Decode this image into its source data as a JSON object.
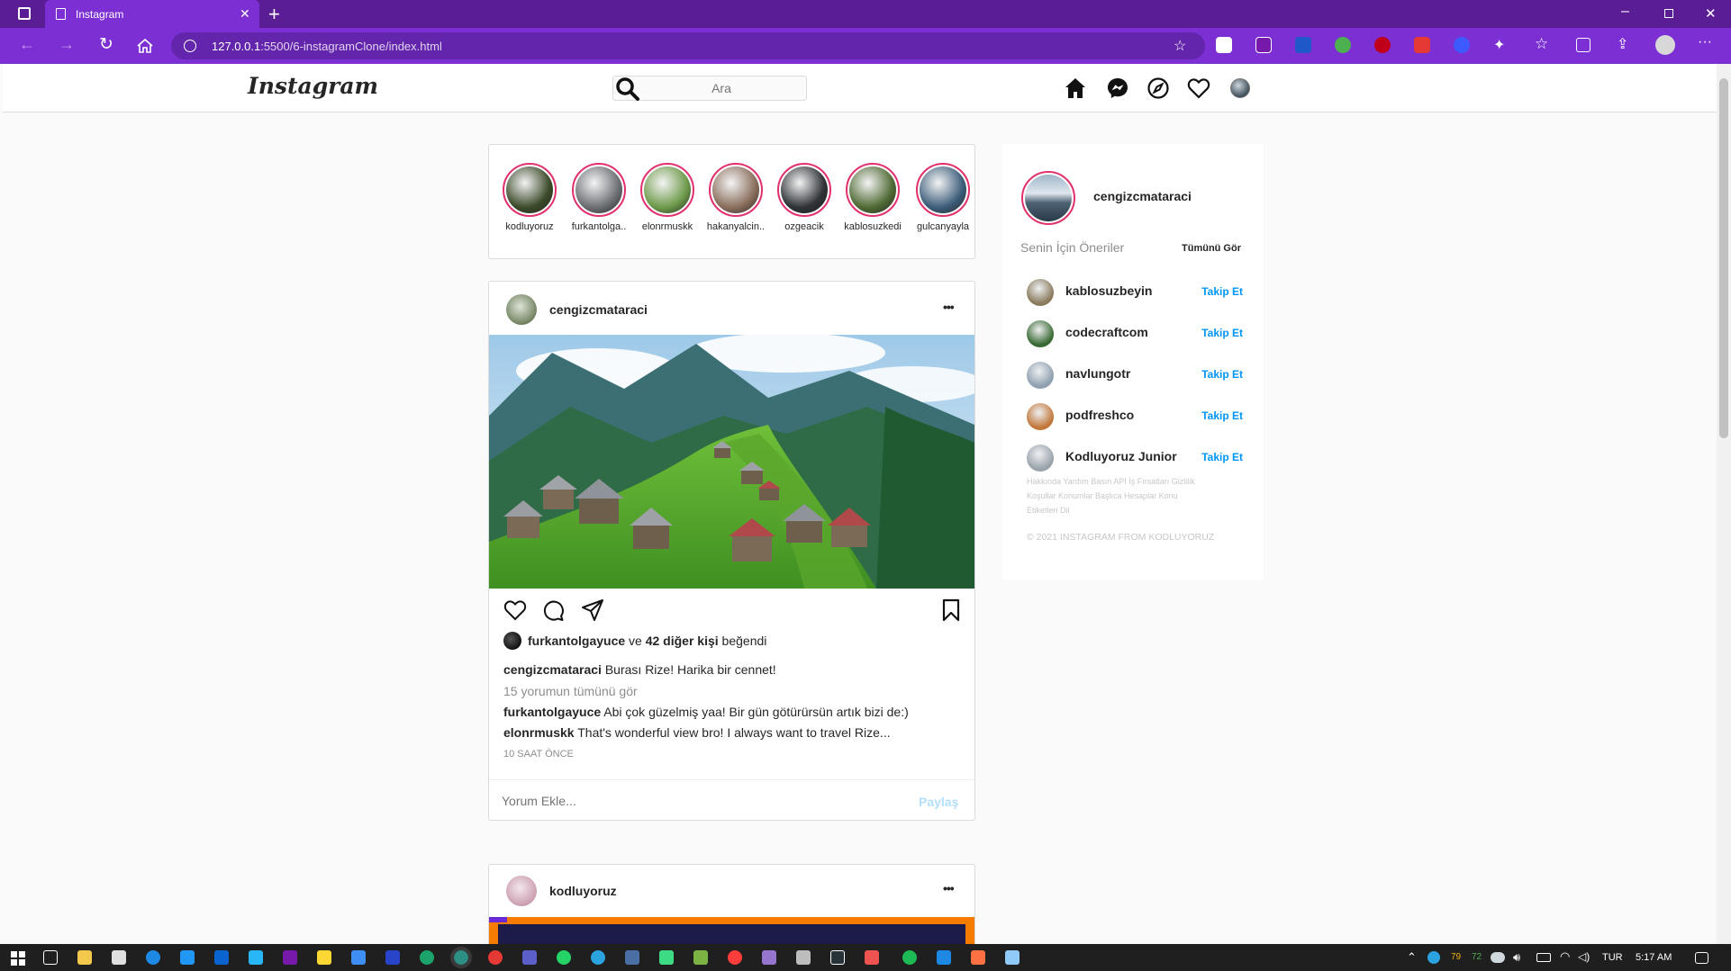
{
  "browser": {
    "tab_title": "Instagram",
    "url_host": "127.0.0.1",
    "url_rest": ":5500/6-instagramClone/index.html",
    "colors": {
      "tabbar": "#5a1d94",
      "toolbar": "#7c2fd3"
    }
  },
  "header": {
    "logo": "Instagram",
    "search_placeholder": "Ara",
    "icons": [
      "home-icon",
      "messenger-icon",
      "explore-icon",
      "heart-icon",
      "profile-avatar"
    ]
  },
  "stories": [
    {
      "name": "kodluyoruz",
      "color": "#3b4a2a"
    },
    {
      "name": "furkantolga..",
      "color": "#6b6e73"
    },
    {
      "name": "elonrmuskk",
      "color": "#6d9a4a"
    },
    {
      "name": "hakanyalcin..",
      "color": "#8a6e5c"
    },
    {
      "name": "ozgeacik",
      "color": "#2e3236"
    },
    {
      "name": "kablosuzkedi",
      "color": "#4f6a34"
    },
    {
      "name": "gulcanyayla",
      "color": "#3c5d7a"
    }
  ],
  "post": {
    "username": "cengizcmataraci",
    "more": "•••",
    "likes_user": "furkantolgayuce",
    "likes_connector": "ve",
    "likes_others": "42 diğer kişi",
    "likes_suffix": "beğendi",
    "caption_user": "cengizcmataraci",
    "caption": "Burası Rize! Harika bir cennet!",
    "view_all": "15 yorumun tümünü gör",
    "comments": [
      {
        "user": "furkantolgayuce",
        "text": "Abi çok güzelmiş yaa! Bir gün götürürsün artık bizi de:)"
      },
      {
        "user": "elonrmuskk",
        "text": "That's wonderful view bro! I always want to travel Rize..."
      }
    ],
    "time": "10 SAAT ÖNCE",
    "comment_placeholder": "Yorum Ekle...",
    "share": "Paylaş"
  },
  "post2": {
    "username": "kodluyoruz",
    "more": "•••"
  },
  "sidebar": {
    "username": "cengizcmataraci",
    "suggest_title": "Senin İçin Öneriler",
    "see_all": "Tümünü Gör",
    "suggestions": [
      {
        "name": "kablosuzbeyin",
        "follow": "Takip Et"
      },
      {
        "name": "codecraftcom",
        "follow": "Takip Et"
      },
      {
        "name": "navlungotr",
        "follow": "Takip Et"
      },
      {
        "name": "podfreshco",
        "follow": "Takip Et"
      },
      {
        "name": "Kodluyoruz Junior",
        "follow": "Takip Et"
      }
    ],
    "footer_links_1": "Hakkında Yardım Basın API İş Fırsatları Gizlilik",
    "footer_links_2": "Koşullar Konumlar Başlıca Hesaplar Konu",
    "footer_links_3": "Etiketleri Dil",
    "copyright": "© 2021 INSTAGRAM FROM KODLUYORUZ"
  },
  "taskbar": {
    "temp_1": "79",
    "temp_2": "72",
    "lang": "TUR",
    "time": "5:17 AM"
  }
}
